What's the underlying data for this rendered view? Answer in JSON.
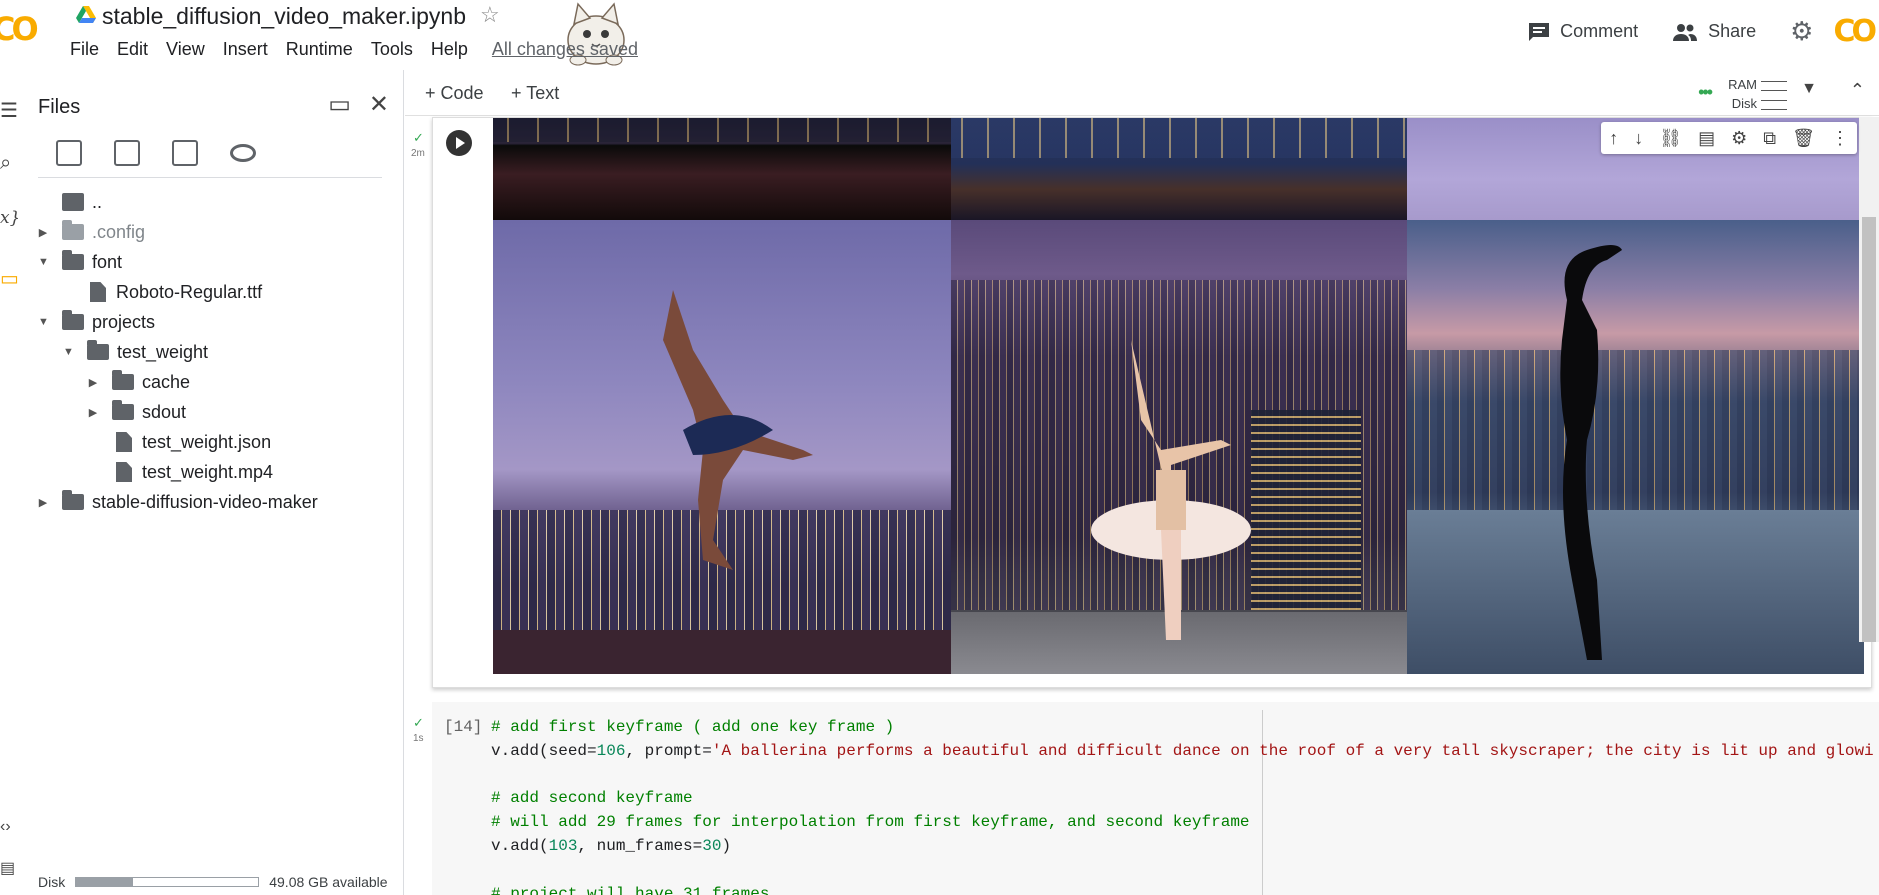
{
  "header": {
    "notebook_title": "stable_diffusion_video_maker.ipynb",
    "menu": [
      "File",
      "Edit",
      "View",
      "Insert",
      "Runtime",
      "Tools",
      "Help"
    ],
    "save_status": "All changes saved",
    "comment_label": "Comment",
    "share_label": "Share"
  },
  "files_panel": {
    "title": "Files",
    "tree": [
      {
        "name": "..",
        "kind": "up",
        "depth": 0
      },
      {
        "name": ".config",
        "kind": "folder",
        "depth": 0,
        "expanded": false,
        "dim": true
      },
      {
        "name": "font",
        "kind": "folder",
        "depth": 0,
        "expanded": true
      },
      {
        "name": "Roboto-Regular.ttf",
        "kind": "file",
        "depth": 1
      },
      {
        "name": "projects",
        "kind": "folder",
        "depth": 0,
        "expanded": true
      },
      {
        "name": "test_weight",
        "kind": "folder",
        "depth": 1,
        "expanded": true
      },
      {
        "name": "cache",
        "kind": "folder",
        "depth": 2,
        "expanded": false
      },
      {
        "name": "sdout",
        "kind": "folder",
        "depth": 2,
        "expanded": false
      },
      {
        "name": "test_weight.json",
        "kind": "file",
        "depth": 2
      },
      {
        "name": "test_weight.mp4",
        "kind": "file",
        "depth": 2
      },
      {
        "name": "stable-diffusion-video-maker",
        "kind": "folder",
        "depth": 0,
        "expanded": false
      }
    ],
    "disk_label": "Disk",
    "disk_available": "49.08 GB available",
    "disk_used_fraction": 0.31
  },
  "toolbar": {
    "add_code": "+ Code",
    "add_text": "+ Text",
    "ram_label": "RAM",
    "disk_label": "Disk"
  },
  "cell_output": {
    "exec_time": "2m"
  },
  "code_cell": {
    "exec_count": "[14]",
    "exec_time": "1s",
    "lines": [
      [
        {
          "t": "# add first keyframe ( add one key frame )",
          "c": "cmt"
        }
      ],
      [
        {
          "t": "v.add(seed=",
          "c": ""
        },
        {
          "t": "106",
          "c": "num"
        },
        {
          "t": ", prompt=",
          "c": ""
        },
        {
          "t": "'A ballerina performs a beautiful and difficult dance on the roof of a very tall skyscraper; the city is lit up and glowi",
          "c": "str"
        }
      ],
      [],
      [
        {
          "t": "# add second keyframe",
          "c": "cmt"
        }
      ],
      [
        {
          "t": "# will add 29 frames for interpolation from first keyframe, and second keyframe",
          "c": "cmt"
        }
      ],
      [
        {
          "t": "v.add(",
          "c": ""
        },
        {
          "t": "103",
          "c": "num"
        },
        {
          "t": ", num_frames=",
          "c": ""
        },
        {
          "t": "30",
          "c": "num"
        },
        {
          "t": ")",
          "c": ""
        }
      ],
      [],
      [
        {
          "t": "# project will have 31 frames",
          "c": "cmt"
        }
      ]
    ]
  },
  "colors": {
    "accent_orange": "#f9ab00",
    "check_green": "#34a853",
    "comment_green": "#008000",
    "string_red": "#a31515",
    "number_green": "#098658"
  }
}
